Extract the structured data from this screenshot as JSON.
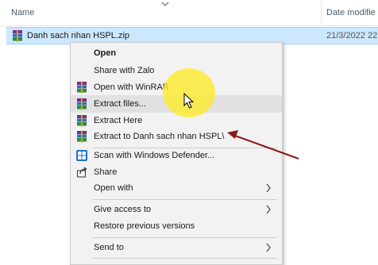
{
  "header": {
    "name_label": "Name",
    "date_label": "Date modifie"
  },
  "file": {
    "name": "Danh sach nhan HSPL.zip",
    "date": "21/3/2022 22:",
    "icon": "winrar-archive-icon"
  },
  "menu": {
    "items": [
      {
        "label": "Open",
        "icon": "none",
        "bold": true
      },
      {
        "label": "Share with Zalo",
        "icon": "none"
      },
      {
        "label": "Open with WinRAR",
        "icon": "winrar-icon"
      },
      {
        "label": "Extract files...",
        "icon": "winrar-icon"
      },
      {
        "label": "Extract Here",
        "icon": "winrar-icon"
      },
      {
        "label": "Extract to Danh sach nhan HSPL\\",
        "icon": "winrar-icon"
      },
      {
        "label": "Scan with Windows Defender...",
        "icon": "windows-defender-icon"
      },
      {
        "label": "Share",
        "icon": "share-icon"
      },
      {
        "label": "Open with",
        "icon": "none",
        "submenu": true
      },
      {
        "label": "Give access to",
        "icon": "none",
        "submenu": true
      },
      {
        "label": "Restore previous versions",
        "icon": "none"
      },
      {
        "label": "Send to",
        "icon": "none",
        "submenu": true
      }
    ]
  },
  "colors": {
    "selection": "#cce8ff",
    "menu_bg": "#f2f2f2",
    "annotation_arrow": "#8b1a1a",
    "highlight": "#ffeb28"
  }
}
